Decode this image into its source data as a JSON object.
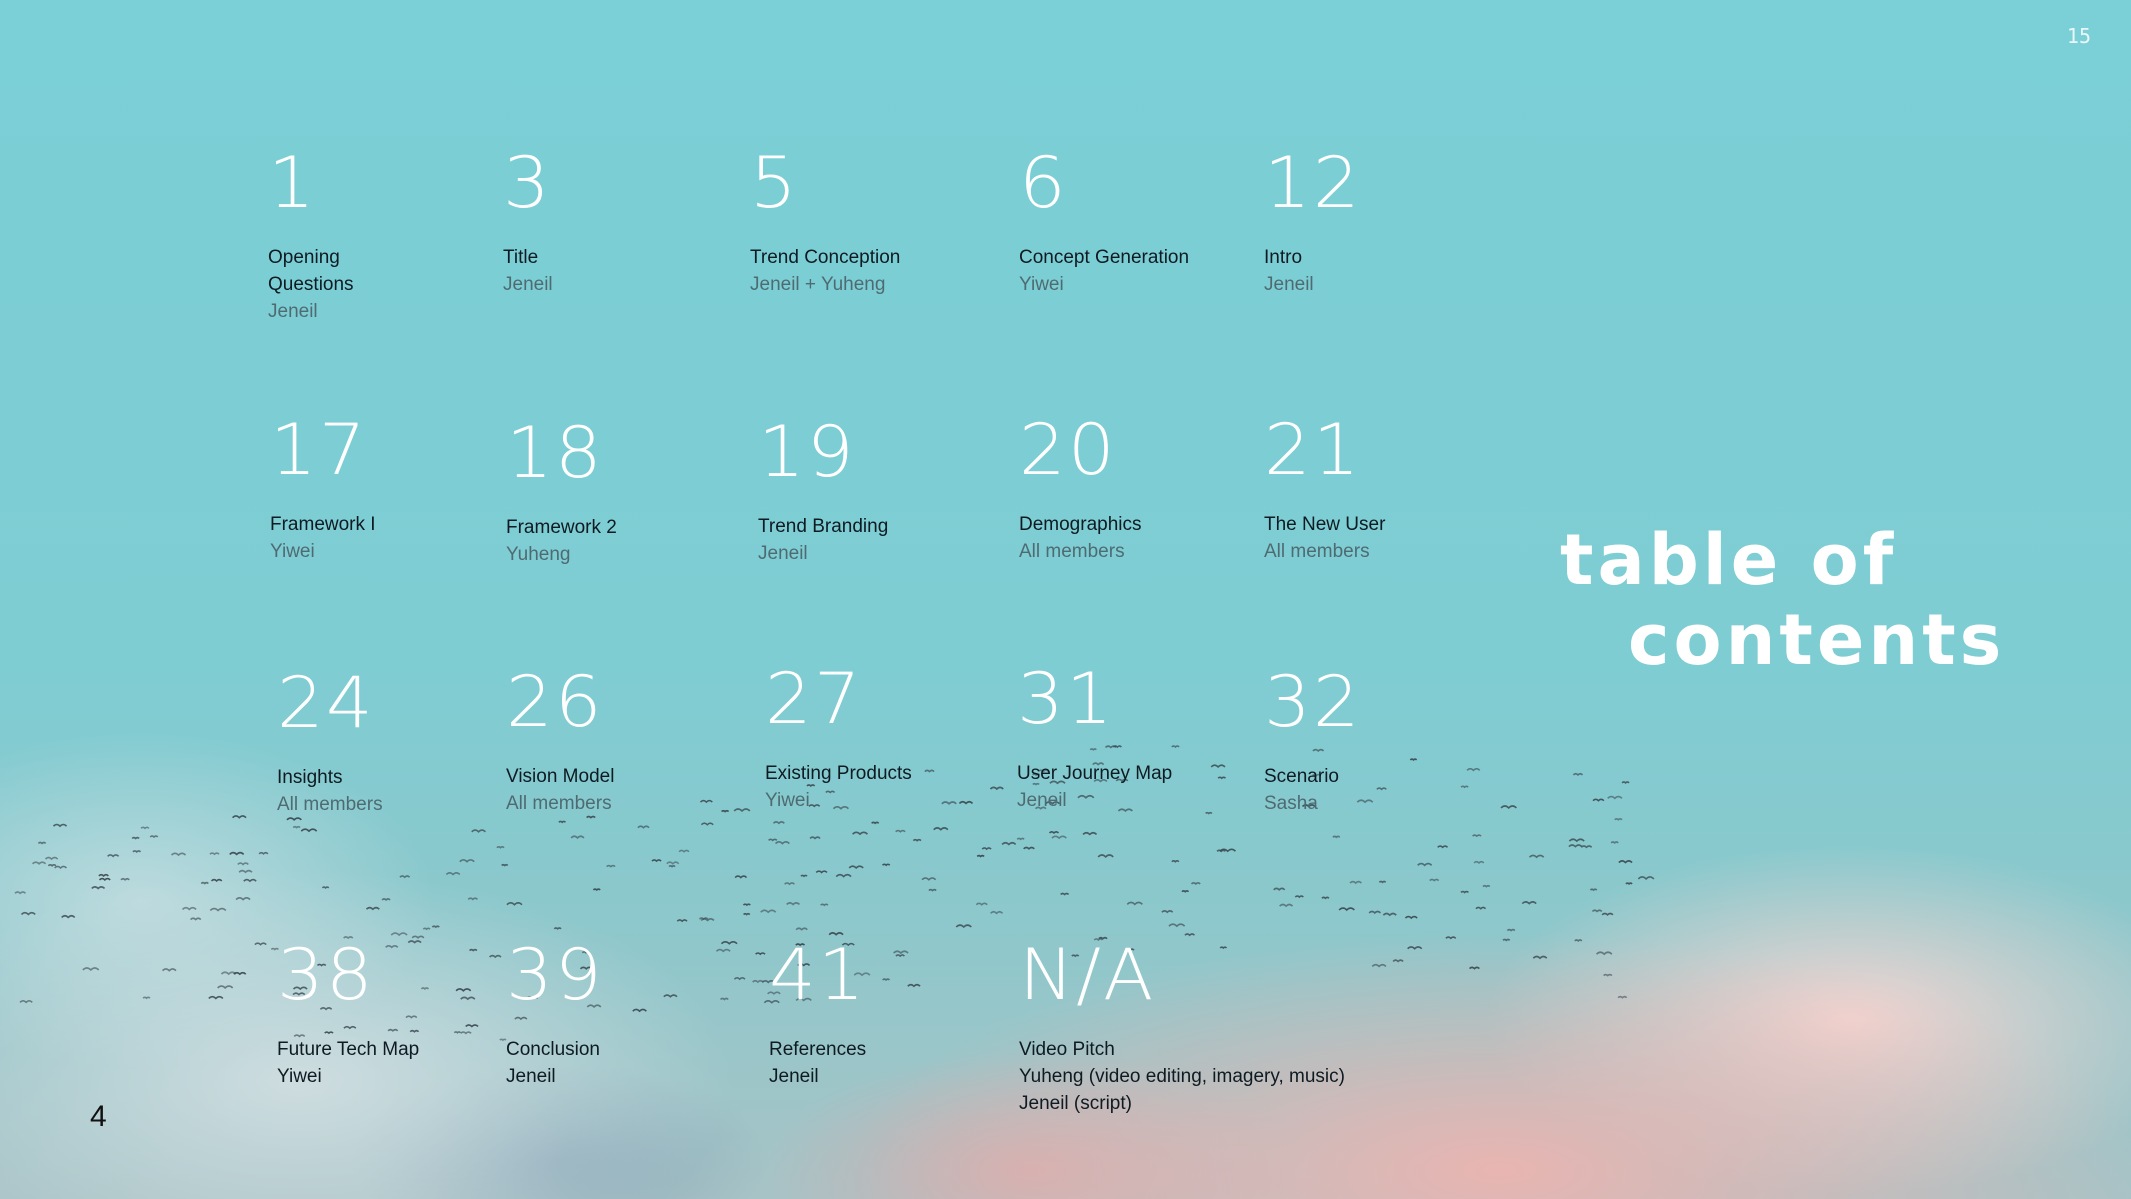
{
  "page_number_top": "15",
  "slide_number": "4",
  "heading": {
    "line1": "table of",
    "line2": "contents"
  },
  "entries": [
    {
      "number": "1",
      "title": "Opening Questions",
      "presenter": "Jeneil"
    },
    {
      "number": "3",
      "title": "Title",
      "presenter": "Jeneil"
    },
    {
      "number": "5",
      "title": "Trend Conception",
      "presenter": "Jeneil + Yuheng"
    },
    {
      "number": "6",
      "title": "Concept Generation",
      "presenter": "Yiwei"
    },
    {
      "number": "12",
      "title": "Intro",
      "presenter": "Jeneil"
    },
    {
      "number": "17",
      "title": "Framework I",
      "presenter": "Yiwei"
    },
    {
      "number": "18",
      "title": "Framework 2",
      "presenter": "Yuheng"
    },
    {
      "number": "19",
      "title": "Trend Branding",
      "presenter": "Jeneil"
    },
    {
      "number": "20",
      "title": "Demographics",
      "presenter": "All members"
    },
    {
      "number": "21",
      "title": "The New User",
      "presenter": "All members"
    },
    {
      "number": "24",
      "title": "Insights",
      "presenter": "All members"
    },
    {
      "number": "26",
      "title": "Vision Model",
      "presenter": "All members"
    },
    {
      "number": "27",
      "title": "Existing Products",
      "presenter": "Yiwei"
    },
    {
      "number": "31",
      "title": "User Journey Map",
      "presenter": "Jeneil"
    },
    {
      "number": "32",
      "title": "Scenario",
      "presenter": "Sasha"
    },
    {
      "number": "38",
      "title": "Future Tech Map",
      "presenter": "Yiwei"
    },
    {
      "number": "39",
      "title": "Conclusion",
      "presenter": "Jeneil"
    },
    {
      "number": "41",
      "title": "References",
      "presenter": "Jeneil"
    },
    {
      "number": "N/A",
      "title": "Video Pitch",
      "presenter": "Yuheng (video editing, imagery, music)",
      "presenter2": "Jeneil (script)"
    }
  ]
}
